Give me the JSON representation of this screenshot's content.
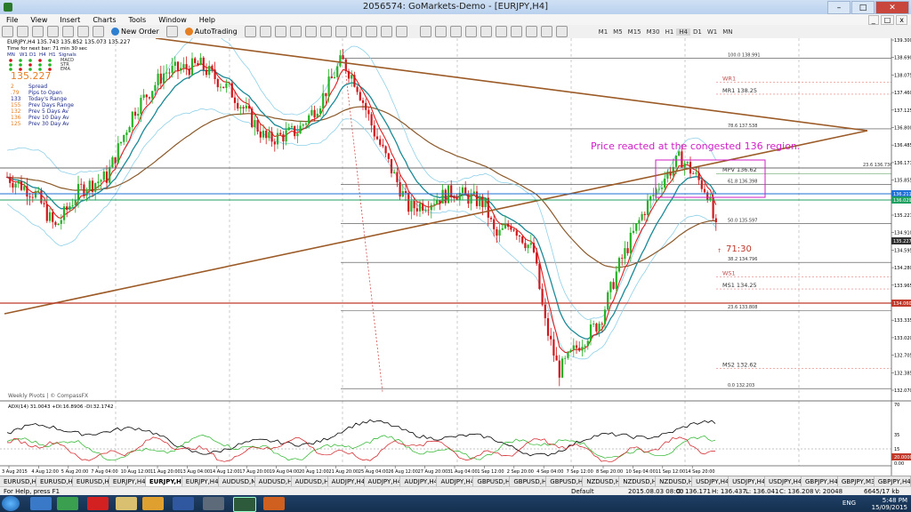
{
  "window": {
    "title": "2056574: GoMarkets-Demo - [EURJPY,H4]"
  },
  "menu": [
    "File",
    "View",
    "Insert",
    "Charts",
    "Tools",
    "Window",
    "Help"
  ],
  "toolbar": {
    "new_order": "New Order",
    "autotrading": "AutoTrading",
    "timeframes": [
      "M1",
      "M5",
      "M15",
      "M30",
      "H1",
      "H4",
      "D1",
      "W1",
      "MN"
    ]
  },
  "infopanel": {
    "header": "EURJPY,H4  135.743 135.852 135.073 135.227",
    "timer": "Time for next bar: 71 min 30 sec",
    "indicators": [
      "MN",
      "W1",
      "D1",
      "H4",
      "H1",
      "Signals"
    ],
    "rows_right": [
      "MACD",
      "STR",
      "EMA"
    ],
    "price": "135.227",
    "stats": [
      {
        "value": "2",
        "label": "Spread"
      },
      {
        "value": ".79",
        "label": "Pips to Open"
      },
      {
        "value": "133",
        "label": "Today's Range"
      },
      {
        "value": "155",
        "label": "Prev Days Range"
      },
      {
        "value": "132",
        "label": "Prev 5 Days Av"
      },
      {
        "value": "136",
        "label": "Prev 10 Day Av"
      },
      {
        "value": "125",
        "label": "Prev 30 Day Av"
      }
    ]
  },
  "annotations": {
    "note": "Price reacted at the congested 136 region.",
    "timer_label": "71:30",
    "watermark": "Weekly Pivots | © CompassFX",
    "indicator_label": "ADX(14) 31.0043 +DI:16.8906 -DI:32.1742"
  },
  "levels": [
    {
      "label": "100.0  138.991",
      "price": 138.991
    },
    {
      "label": "WR1",
      "price": 138.5
    },
    {
      "label": "MR1    138.25",
      "price": 138.25
    },
    {
      "label": "78.6  137.538",
      "price": 137.538
    },
    {
      "label": "23.6  136.736",
      "price": 136.736
    },
    {
      "label": "MPV    136.62",
      "price": 136.62
    },
    {
      "label": "61.8  136.398",
      "price": 136.398
    },
    {
      "label": "50.0  135.597",
      "price": 135.597
    },
    {
      "label": "38.2  134.796",
      "price": 134.796
    },
    {
      "label": "WS1",
      "price": 134.5
    },
    {
      "label": "MS1    134.25",
      "price": 134.25
    },
    {
      "label": "23.6  133.808",
      "price": 133.808
    },
    {
      "label": "MS2    132.62",
      "price": 132.62
    },
    {
      "label": "0.0  132.203",
      "price": 132.203
    }
  ],
  "price_axis": [
    "139.300",
    "138.690",
    "138.075",
    "137.460",
    "137.125",
    "136.800",
    "136.485",
    "136.171",
    "135.855",
    "135.540",
    "135.227",
    "134.910",
    "134.595",
    "134.280",
    "133.965",
    "133.650",
    "133.335",
    "133.020",
    "132.705",
    "132.385",
    "132.070"
  ],
  "axis_markers": [
    {
      "label": "136.211",
      "color": "#1e6fd6"
    },
    {
      "label": "136.029",
      "color": "#20a060"
    },
    {
      "label": "135.227",
      "color": "#303030"
    },
    {
      "label": "134.060",
      "color": "#c0392b"
    }
  ],
  "time_axis": [
    "3 Aug 2015",
    "4 Aug 12:00",
    "5 Aug 20:00",
    "7 Aug 04:00",
    "10 Aug 12:00",
    "11 Aug 20:00",
    "13 Aug 04:00",
    "14 Aug 12:00",
    "17 Aug 20:00",
    "19 Aug 04:00",
    "20 Aug 12:00",
    "21 Aug 20:00",
    "25 Aug 04:00",
    "26 Aug 12:00",
    "27 Aug 20:00",
    "31 Aug 04:00",
    "1 Sep 12:00",
    "2 Sep 20:00",
    "4 Sep 04:00",
    "7 Sep 12:00",
    "8 Sep 20:00",
    "10 Sep 04:00",
    "11 Sep 12:00",
    "14 Sep 20:00"
  ],
  "adx_axis": [
    "70",
    "35",
    "15",
    "0.00",
    "20.0000"
  ],
  "tabs": [
    "EURUSD,H4",
    "EURUSD,H4",
    "EURUSD,H4",
    "EURJPY,H4",
    "EURJPY,H4",
    "EURJPY,H4",
    "AUDUSD,M30",
    "AUDUSD,H4",
    "AUDUSD,H4",
    "AUDJPY,H4",
    "AUDJPY,H4",
    "AUDJPY,H4",
    "AUDJPY,H4",
    "GBPUSD,H4",
    "GBPUSD,H4",
    "GBPUSD,H4",
    "NZDUSD,H4",
    "NZDUSD,H4",
    "NZDUSD,H4",
    "USDJPY,H4",
    "USDJPY,H4",
    "USDJPY,H4",
    "GBPJPY,H4",
    "GBPJPY,M30",
    "GBPJPY,H4"
  ],
  "active_tab": 4,
  "status": {
    "help": "For Help, press F1",
    "profile": "Default",
    "time": "2015.08.03 08:00",
    "o": "O: 136.171",
    "h": "H: 136.437",
    "l": "L: 136.041",
    "c": "C: 136.208",
    "v": "V: 20048",
    "kb": "6645/17 kb"
  },
  "taskbar": {
    "lang": "ENG",
    "time": "5:48 PM",
    "date": "15/09/2015"
  },
  "colors": {
    "bull": "#24b324",
    "bear": "#d0171c",
    "ema_red": "#e02020",
    "ema_teal": "#1b8a96",
    "ema_brown": "#8b5a2b",
    "bollinger": "#8fd0e8",
    "trend": "#9b5a26",
    "note": "#d21fc8"
  }
}
